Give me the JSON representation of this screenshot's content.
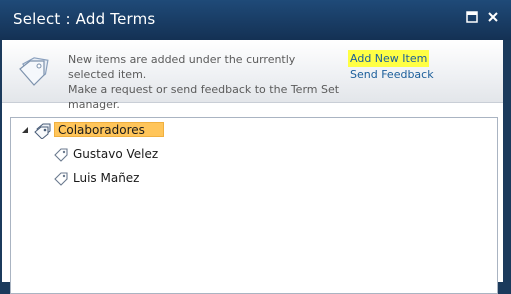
{
  "dialog": {
    "title": "Select : Add Terms"
  },
  "infobar": {
    "line1": "New items are added under the currently selected item.",
    "line2": "Make a request or send feedback to the Term Set manager.",
    "add_new_item": "Add New Item",
    "send_feedback": "Send Feedback"
  },
  "tree": {
    "term_set": "Colaboradores",
    "terms": [
      "Gustavo Velez",
      "Luis Mañez"
    ]
  },
  "colors": {
    "titlebar": "#1f4a78",
    "link": "#1b5e9a",
    "highlight": "#ffff44",
    "selected": "#ffc55a"
  }
}
